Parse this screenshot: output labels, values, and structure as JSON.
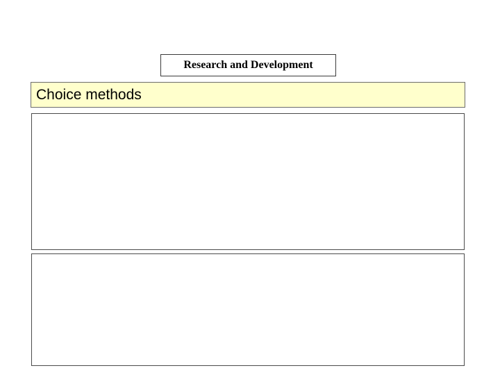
{
  "slide": {
    "heading": "Research and Development",
    "title": "Choice methods"
  },
  "colors": {
    "title_bar_background": "#ffffcc",
    "border": "#4a4a4a",
    "background": "#ffffff"
  }
}
